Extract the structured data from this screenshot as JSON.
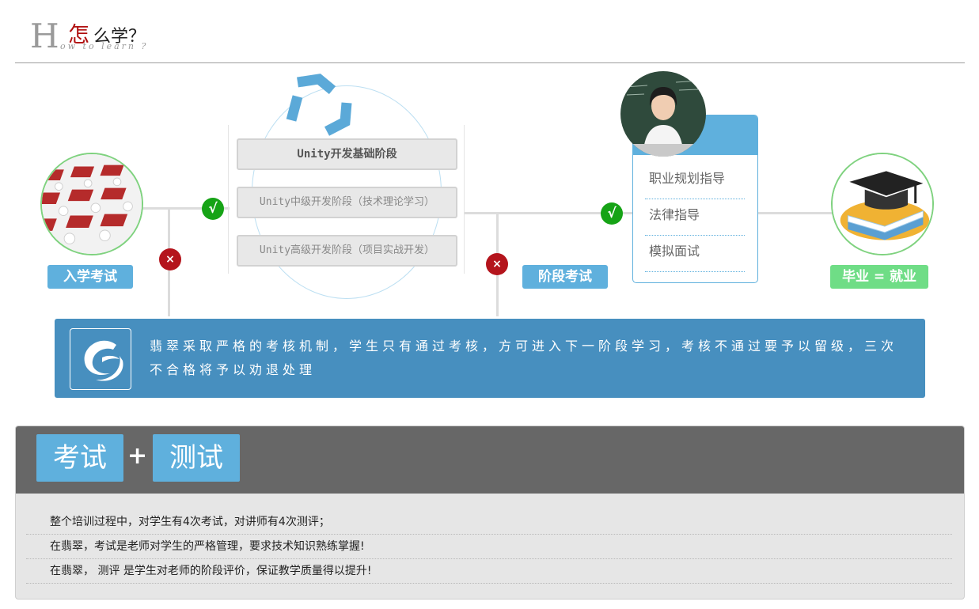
{
  "header": {
    "big_letter": "H",
    "title_zen": "怎",
    "title_rest": "么学？",
    "subtitle": "ow to learn ?"
  },
  "flow": {
    "entrance_label": "入学考试",
    "stages": [
      "Unity开发基础阶段",
      "Unity中级开发阶段（技术理论学习）",
      "Unity高级开发阶段（项目实战开发）"
    ],
    "stage_exam_label": "阶段考试",
    "guidance": [
      "职业规划指导",
      "法律指导",
      "模拟面试"
    ],
    "graduate_label": "毕业 = 就业",
    "pass_mark": "√",
    "fail_mark": "×"
  },
  "info": {
    "text": "翡翠采取严格的考核机制，学生只有通过考核，方可进入下一阶段学习，考核不通过要予以留级，三次不合格将予以劝退处理"
  },
  "panel": {
    "pill1": "考试",
    "plus": "+",
    "pill2": "测试",
    "rows": [
      "整个培训过程中，对学生有4次考试，对讲师有4次测评；",
      "在翡翠，考试是老师对学生的严格管理，要求技术知识熟练掌握!",
      "在翡翠，  测评 是学生对老师的阶段评价，保证教学质量得以提升!"
    ]
  },
  "colors": {
    "accent_blue": "#5fb0dd",
    "info_blue": "#478fbf",
    "pass_green": "#16a316",
    "fail_red": "#b4141c",
    "grad_green": "#6fdd86"
  }
}
